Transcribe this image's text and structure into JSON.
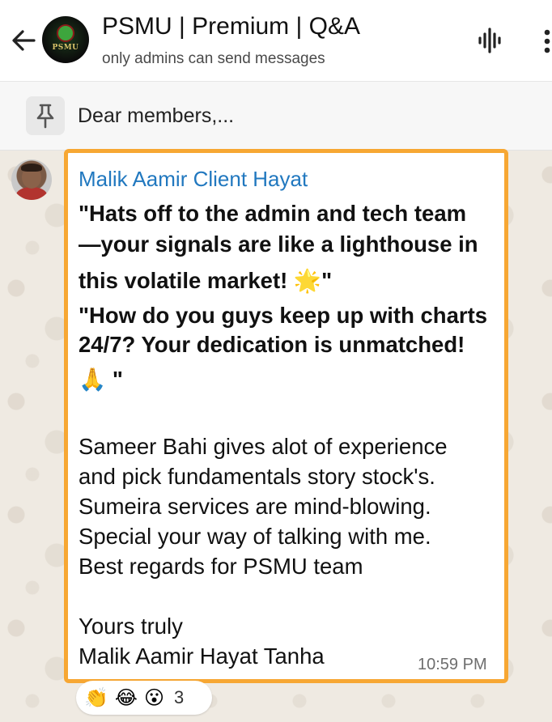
{
  "header": {
    "title": "PSMU | Premium | Q&A",
    "subtitle": "only admins can send messages",
    "avatar_text": "PSMU",
    "back_icon": "arrow-left-icon",
    "voice_icon": "voice-waveform-icon",
    "menu_icon": "more-vertical-icon"
  },
  "pinned": {
    "icon": "pin-icon",
    "text": "Dear members,..."
  },
  "message": {
    "sender_name": "Malik Aamir Client Hayat",
    "lines": {
      "l1": "\"Hats off to the admin and tech team",
      "l2": "—your signals are like a lighthouse in",
      "l3": "this volatile market! 🌟\"",
      "l4": "\"How do you guys keep up with charts",
      "l5": "24/7? Your dedication is unmatched!",
      "l6": "🙏 \"",
      "l7": "Sameer Bahi gives alot of experience",
      "l8": "and pick fundamentals story stock's.",
      "l9": "Sumeira services are mind-blowing.",
      "l10": "Special your way of talking with me.",
      "l11": "Best regards for PSMU team",
      "l12": "Yours truly",
      "l13": "Malik Aamir Hayat Tanha"
    },
    "time": "10:59 PM"
  },
  "reactions": {
    "r1": "👏",
    "r2": "😂",
    "r3": "😮",
    "count": "3"
  },
  "colors": {
    "highlight_border": "#f7a733",
    "sender_name": "#2178bf",
    "chat_background": "#efeae2"
  }
}
